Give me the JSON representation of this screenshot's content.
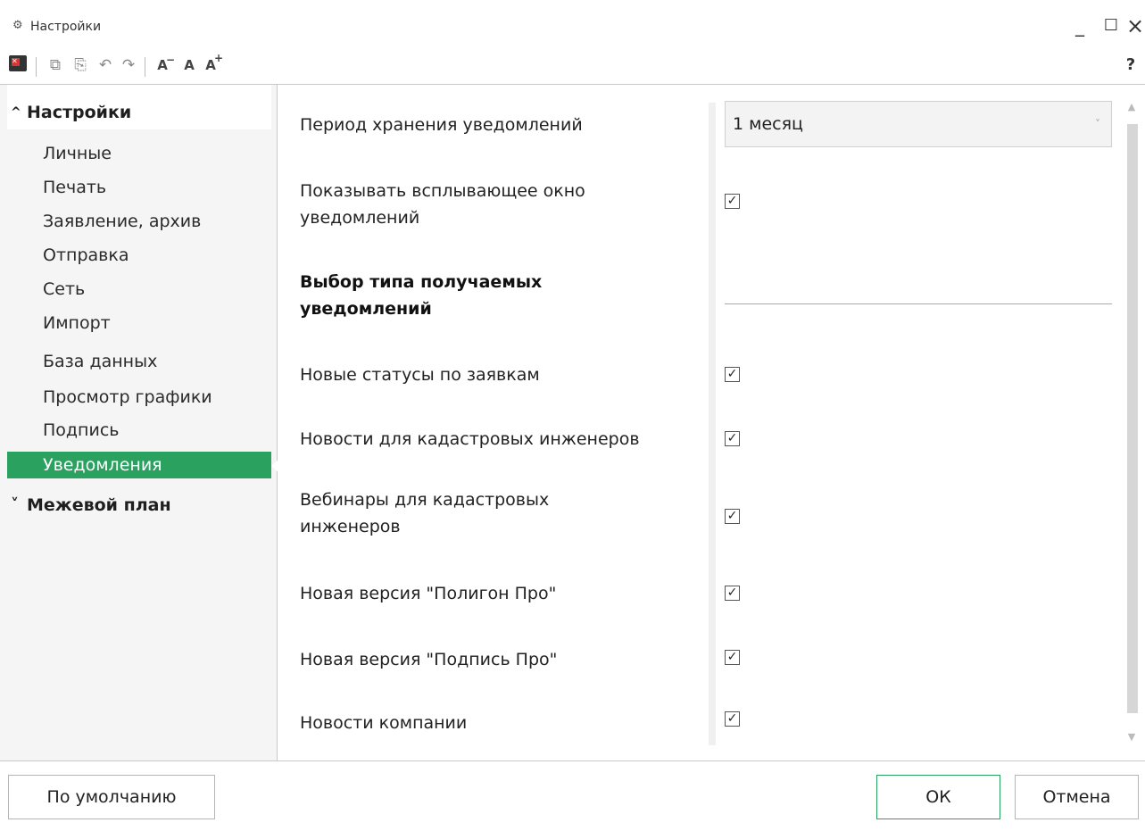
{
  "window": {
    "title": "Настройки",
    "minimize": "_",
    "maximize": "☐",
    "close": "×",
    "help": "?"
  },
  "toolbar": {
    "undo_icon": "↶",
    "redo_icon": "↷",
    "font_letter": "A",
    "font_decrease_mark": "−",
    "font_increase_mark": "+"
  },
  "nav": {
    "groups": [
      {
        "label": "Настройки",
        "expanded": true,
        "chevron": "^"
      },
      {
        "label": "Межевой план",
        "expanded": false,
        "chevron": "˅"
      }
    ],
    "items": [
      {
        "label": "Личные"
      },
      {
        "label": "Печать"
      },
      {
        "label": "Заявление, архив"
      },
      {
        "label": "Отправка"
      },
      {
        "label": "Сеть"
      },
      {
        "label": "Импорт"
      },
      {
        "label": "База данных"
      },
      {
        "label": "Просмотр графики"
      },
      {
        "label": "Подпись"
      },
      {
        "label": "Уведомления",
        "active": true
      }
    ],
    "active_color": "#2ba160"
  },
  "content": {
    "period_label": "Период хранения уведомлений",
    "period_value": "1 месяц",
    "popup_label_line1": "Показывать всплывающее окно",
    "popup_label_line2": "уведомлений",
    "popup_checked": true,
    "section_title_line1": "Выбор типа получаемых",
    "section_title_line2": "уведомлений",
    "options": [
      {
        "label": "Новые статусы по заявкам",
        "checked": true
      },
      {
        "label": "Новости для кадастровых инженеров",
        "checked": true
      },
      {
        "label_line1": "Вебинары для кадастровых",
        "label_line2": "инженеров",
        "checked": true
      },
      {
        "label": "Новая версия \"Полигон Про\"",
        "checked": true
      },
      {
        "label": "Новая версия \"Подпись Про\"",
        "checked": true
      },
      {
        "label": "Новости компании",
        "checked": true
      }
    ],
    "check_mark": "✓"
  },
  "footer": {
    "default_button": "По умолчанию",
    "ok_button": "ОК",
    "cancel_button": "Отмена"
  }
}
